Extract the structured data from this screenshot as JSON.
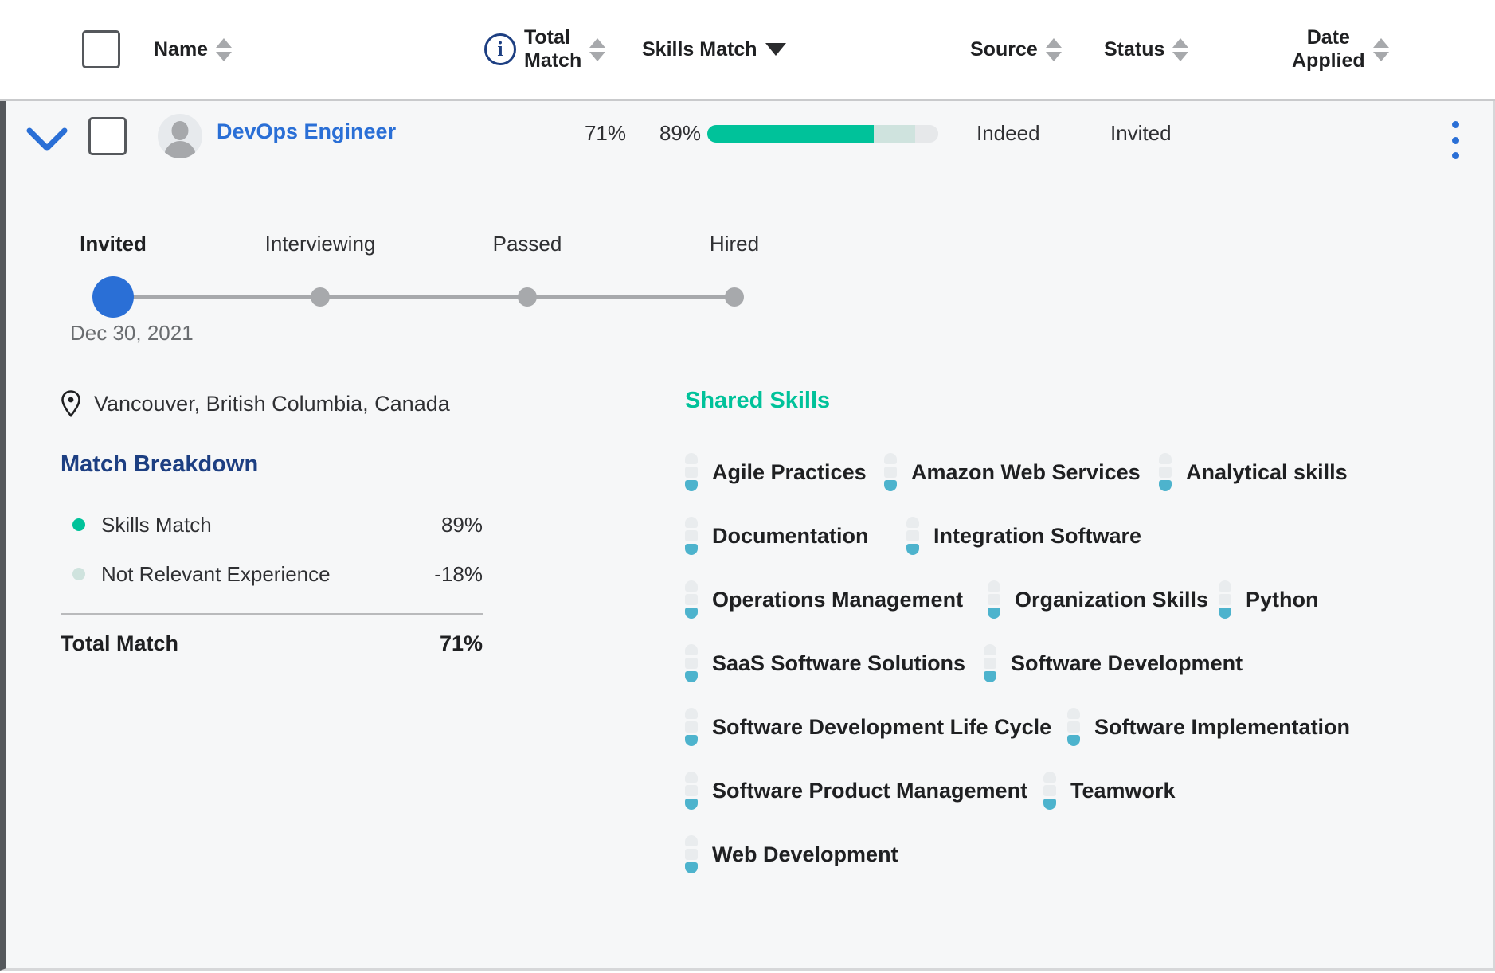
{
  "table_header": {
    "select_all_checkbox": "",
    "columns": [
      {
        "key": "name",
        "label": "Name",
        "sort": "both"
      },
      {
        "key": "total",
        "label_line1": "Total",
        "label_line2": "Match",
        "sort": "both",
        "icon": "info-icon"
      },
      {
        "key": "skills",
        "label": "Skills Match",
        "sort": "desc-active"
      },
      {
        "key": "source",
        "label": "Source",
        "sort": "both"
      },
      {
        "key": "status",
        "label": "Status",
        "sort": "both"
      },
      {
        "key": "date",
        "label_line1": "Date",
        "label_line2": "Applied",
        "sort": "both"
      }
    ]
  },
  "candidate": {
    "name": "DevOps Engineer",
    "total_match": "71%",
    "skills_match": "89%",
    "source": "Indeed",
    "status": "Invited",
    "skills_bar": {
      "match_pct": 72,
      "partial_pct": 18,
      "remaining_pct": 10,
      "color_match": "#00c29a",
      "color_partial": "#cfe3de",
      "color_remaining": "#e6e8ea"
    },
    "location": "Vancouver, British Columbia, Canada",
    "applied_date": "Dec 30, 2021"
  },
  "stepper": {
    "steps": [
      {
        "label": "Invited",
        "active": true
      },
      {
        "label": "Interviewing",
        "active": false
      },
      {
        "label": "Passed",
        "active": false
      },
      {
        "label": "Hired",
        "active": false
      }
    ],
    "active_color": "#2a6fd6",
    "inactive_color": "#a7a9ac"
  },
  "match_breakdown": {
    "title": "Match Breakdown",
    "rows": [
      {
        "label": "Skills Match",
        "value": "89%",
        "dot_color": "#00c29a"
      },
      {
        "label": "Not Relevant Experience",
        "value": "-18%",
        "dot_color": "#cfe3de"
      }
    ],
    "total_label": "Total Match",
    "total_value": "71%"
  },
  "shared_skills": {
    "title": "Shared Skills",
    "meter_segments": 3,
    "meter_filled": 1,
    "meter_on_color": "#4db3cd",
    "meter_off_color": "#e9ecee",
    "lines": [
      [
        "Agile Practices",
        "Amazon Web Services",
        "Analytical skills"
      ],
      [
        "Documentation",
        "Integration Software"
      ],
      [
        "Operations Management",
        "Organization Skills",
        "Python"
      ],
      [
        "SaaS Software Solutions",
        "Software Development"
      ],
      [
        "Software Development Life Cycle",
        "Software Implementation"
      ],
      [
        "Software Product Management",
        "Teamwork"
      ],
      [
        "Web Development"
      ]
    ]
  }
}
